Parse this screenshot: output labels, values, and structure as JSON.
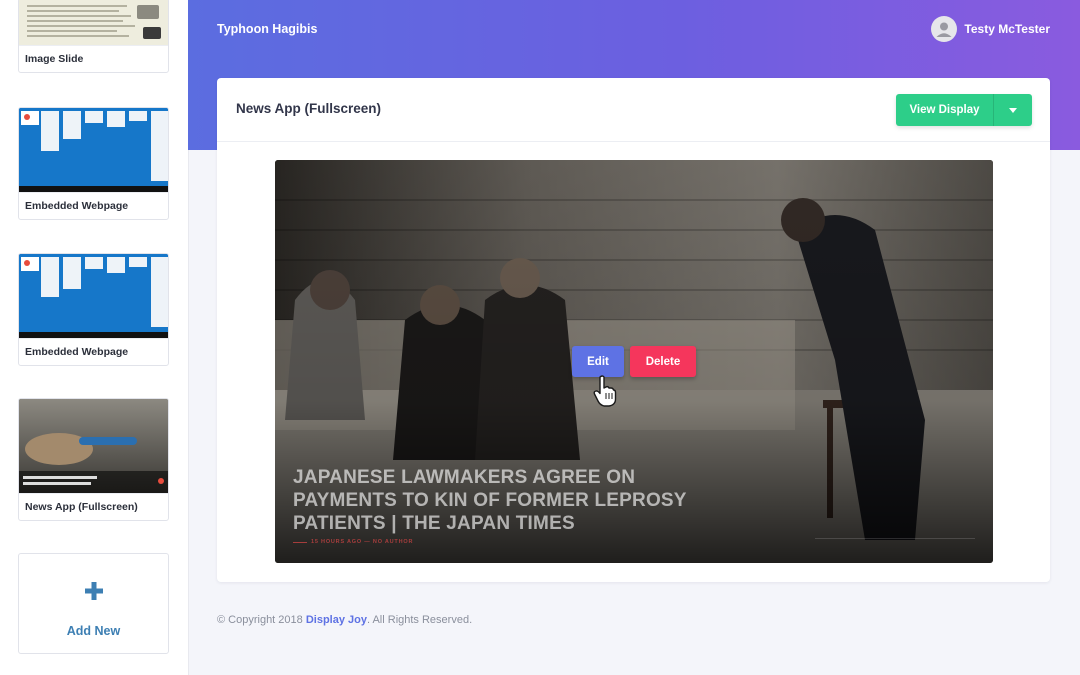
{
  "header": {
    "org_name": "Typhoon Hagibis",
    "user_name": "Testy McTester"
  },
  "sidebar": {
    "slides": [
      {
        "label": "Image Slide",
        "thumb_type": "image"
      },
      {
        "label": "Embedded Webpage",
        "thumb_type": "web"
      },
      {
        "label": "Embedded Webpage",
        "thumb_type": "web"
      },
      {
        "label": "News App (Fullscreen)",
        "thumb_type": "news"
      }
    ],
    "add_label": "Add New"
  },
  "main": {
    "title": "News App (Fullscreen)",
    "view_button_label": "View Display",
    "preview": {
      "headline": "Japanese lawmakers agree on payments to kin of former leprosy patients | The Japan Times",
      "meta": "15 HOURS AGO — NO AUTHOR",
      "edit_label": "Edit",
      "delete_label": "Delete"
    }
  },
  "footer": {
    "prefix": "© Copyright 2018",
    "brand": "Display Joy",
    "suffix": ". All Rights Reserved."
  },
  "colors": {
    "header_gradient_start": "#5b6de0",
    "header_gradient_end": "#8a5bdf",
    "view_button": "#2dce89",
    "edit_button": "#5e72e4",
    "delete_button": "#f5365c",
    "add_new": "#3d7fb3"
  },
  "icons": {
    "avatar": "user-avatar-icon",
    "add": "plus-icon",
    "dropdown": "caret-down-icon",
    "cursor": "hand-pointer-icon"
  }
}
